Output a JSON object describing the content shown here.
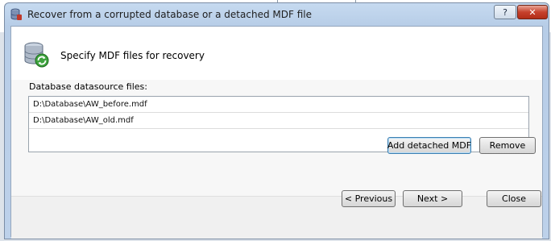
{
  "window": {
    "title": "Recover from a corrupted database or a detached MDF file",
    "help_glyph": "?",
    "close_glyph": "✕",
    "title_icon": "database-recovery-icon"
  },
  "header": {
    "title": "Specify MDF files for recovery",
    "icon": "database-refresh-icon"
  },
  "files": {
    "label": "Database datasource files:",
    "items": [
      "D:\\Database\\AW_before.mdf",
      "D:\\Database\\AW_old.mdf"
    ]
  },
  "buttons": {
    "add": "Add detached MDF",
    "remove": "Remove",
    "previous": "< Previous",
    "next": "Next >",
    "close": "Close"
  }
}
